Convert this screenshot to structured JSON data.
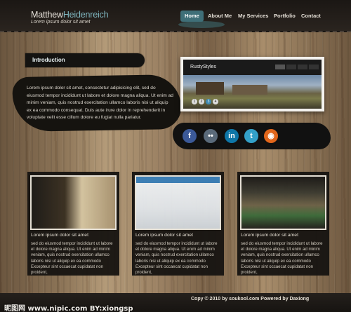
{
  "header": {
    "logo_first": "Matthew",
    "logo_second": "Heidenreich",
    "tagline": "Lorem ipsum dolor sit amet",
    "nav": [
      "Home",
      "About Me",
      "My Services",
      "Portfolio",
      "Contact"
    ]
  },
  "intro": {
    "title": "Introduction",
    "text": "Lorem ipsum dolor sit amet, consectetur adipisicing elit, sed do eiusmod tempor incididunt ut labore et dolore magna aliqua. Ut enim ad minim veniam, quis nostrud exercitation ullamco laboris nisi ut aliquip ex ea commodo consequat. Duis aute irure dolor in reprehenderit in voluptate velit esse cillum dolore eu fugiat nulla pariatur."
  },
  "slider": {
    "title": "RustyStyles",
    "pages": [
      "1",
      "2",
      "3",
      "4"
    ],
    "active_page": "3"
  },
  "social": [
    {
      "icon": "facebook-icon",
      "glyph": "f",
      "color": "#3b5998"
    },
    {
      "icon": "flickr-icon",
      "glyph": "••",
      "color": "#5a6a7a"
    },
    {
      "icon": "linkedin-icon",
      "glyph": "in",
      "color": "#0e76a8"
    },
    {
      "icon": "twitter-icon",
      "glyph": "t",
      "color": "#33a0c8"
    },
    {
      "icon": "rss-icon",
      "glyph": "◉",
      "color": "#e2661b"
    }
  ],
  "columns": [
    {
      "title": "Lorem ipsum dolor sit amet",
      "text": "sed do eiusmod tempor incididunt ut labore et dolore magna aliqua. Ut enim ad minim veniam, quis nostrud exercitation ullamco laboris nisi ut aliquip ex ea commodo Excepteur sint occaecat cupidatat non proident,"
    },
    {
      "title": "Lorem ipsum dolor sit amet",
      "text": "sed do eiusmod tempor incididunt ut labore et dolore magna aliqua. Ut enim ad minim veniam, quis nostrud exercitation ullamco laboris nisi ut aliquip ex ea commodo Excepteur sint occaecat cupidatat non proident,"
    },
    {
      "title": "Lorem ipsum dolor sit amet",
      "text": "sed do eiusmod tempor incididunt ut labore et dolore magna aliqua. Ut enim ad minim veniam, quis nostrud exercitation ullamco laboris nisi ut aliquip ex ea commodo Excepteur sint occaecat cupidatat non proident,"
    }
  ],
  "footer": {
    "copyright": "Copy © 2010 by soukool.com  Powered by Daxiong",
    "watermark": "昵图网 www.nipic.com  BY:xiongsp"
  }
}
